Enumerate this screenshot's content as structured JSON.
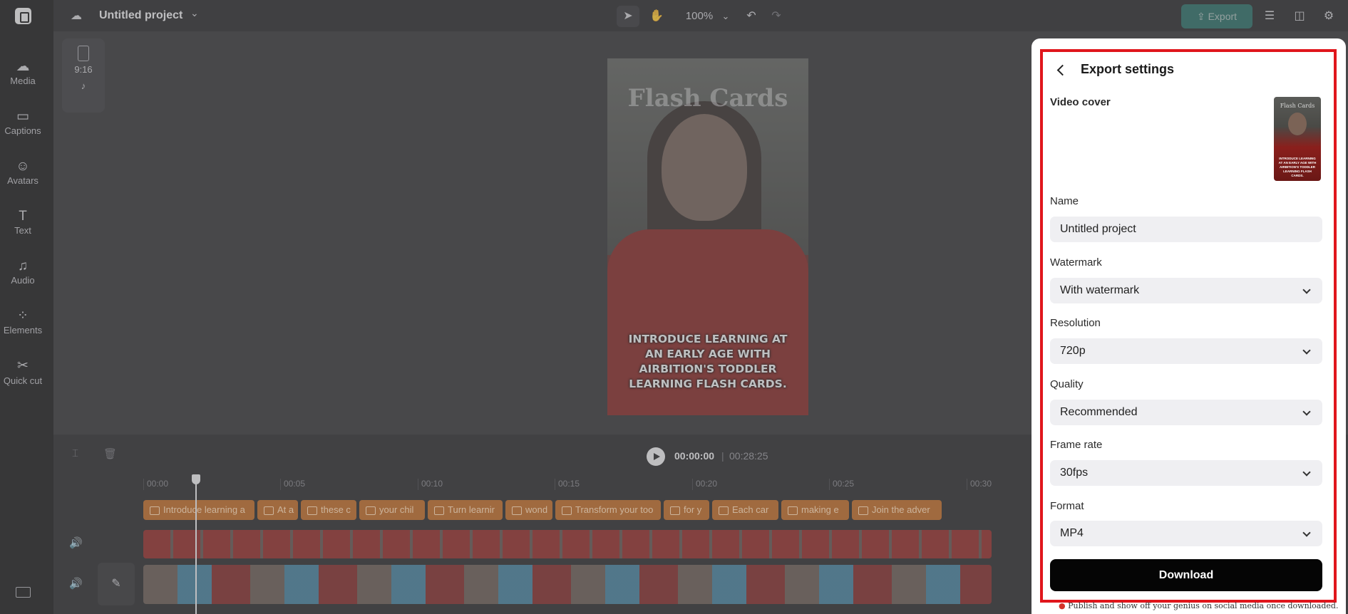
{
  "app": {
    "project_title": "Untitled project",
    "zoom": "100%",
    "export_label": "Export"
  },
  "sidebar": {
    "items": [
      {
        "label": "Media",
        "icon": "cloud-upload-icon"
      },
      {
        "label": "Captions",
        "icon": "captions-icon"
      },
      {
        "label": "Avatars",
        "icon": "avatar-icon"
      },
      {
        "label": "Text",
        "icon": "text-icon"
      },
      {
        "label": "Audio",
        "icon": "music-note-icon"
      },
      {
        "label": "Elements",
        "icon": "elements-icon"
      },
      {
        "label": "Quick cut",
        "icon": "scissors-icon"
      }
    ]
  },
  "canvas": {
    "ratio_label": "9:16",
    "preview_title": "Flash Cards",
    "preview_caption": "INTRODUCE LEARNING AT AN EARLY AGE WITH AIRBITION'S TODDLER LEARNING FLASH CARDS."
  },
  "timeline": {
    "current_time": "00:00:00",
    "separator": "|",
    "duration": "00:28:25",
    "ticks": [
      "00:00",
      "00:05",
      "00:10",
      "00:15",
      "00:20",
      "00:25",
      "00:30"
    ],
    "caption_clips": [
      "Introduce learning a",
      "At a",
      "these c",
      "your chil",
      "Turn learnir",
      "wond",
      "Transform your too",
      "for y",
      "Each car",
      "making e",
      "Join the adver"
    ]
  },
  "export_panel": {
    "title": "Export settings",
    "video_cover_label": "Video cover",
    "cover_title": "Flash Cards",
    "cover_caption": "INTRODUCE LEARNING AT AN EARLY AGE WITH AIRBITION'S TODDLER LEARNING FLASH CARDS.",
    "name_label": "Name",
    "name_value": "Untitled project",
    "watermark_label": "Watermark",
    "watermark_value": "With watermark",
    "resolution_label": "Resolution",
    "resolution_value": "720p",
    "quality_label": "Quality",
    "quality_value": "Recommended",
    "frame_rate_label": "Frame rate",
    "frame_rate_value": "30fps",
    "format_label": "Format",
    "format_value": "MP4",
    "download_label": "Download",
    "hint": "Publish and show off your genius on social media once downloaded."
  },
  "colors": {
    "accent_export": "#1f7a6f",
    "highlight_frame": "#e0161c",
    "caption_clip": "#b9621a"
  }
}
